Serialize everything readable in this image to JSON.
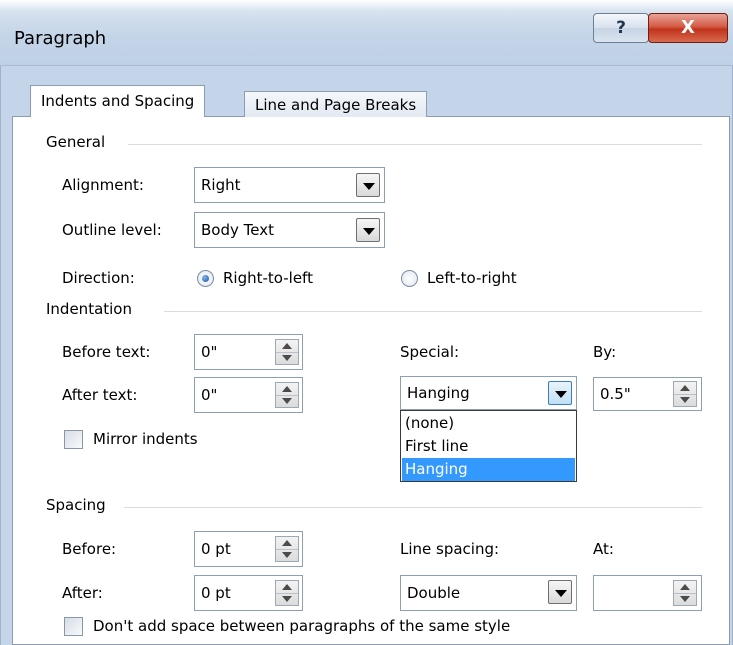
{
  "window": {
    "title": "Paragraph",
    "help_glyph": "?",
    "close_glyph": "X"
  },
  "tabs": [
    {
      "label": "Indents and Spacing",
      "active": true
    },
    {
      "label": "Line and Page Breaks",
      "active": false
    }
  ],
  "general": {
    "heading": "General",
    "alignment": {
      "label": "Alignment:",
      "value": "Right"
    },
    "outline_level": {
      "label": "Outline level:",
      "value": "Body Text"
    },
    "direction": {
      "label": "Direction:",
      "options": [
        {
          "label": "Right-to-left",
          "checked": true
        },
        {
          "label": "Left-to-right",
          "checked": false
        }
      ]
    }
  },
  "indentation": {
    "heading": "Indentation",
    "before_text": {
      "label": "Before text:",
      "value": "0\""
    },
    "after_text": {
      "label": "After text:",
      "value": "0\""
    },
    "special": {
      "label": "Special:",
      "value": "Hanging",
      "options": [
        "(none)",
        "First line",
        "Hanging"
      ],
      "selected_option": "Hanging"
    },
    "by": {
      "label": "By:",
      "value": "0.5\""
    },
    "mirror_indents": {
      "label": "Mirror indents",
      "checked": false
    }
  },
  "spacing": {
    "heading": "Spacing",
    "before": {
      "label": "Before:",
      "value": "0 pt"
    },
    "after": {
      "label": "After:",
      "value": "0 pt"
    },
    "line_spacing": {
      "label": "Line spacing:",
      "value": "Double"
    },
    "at": {
      "label": "At:",
      "value": ""
    },
    "no_space_same_style": {
      "label": "Don't add space between paragraphs of the same style",
      "checked": false
    }
  },
  "colors": {
    "titlebar": "#c3d4e8",
    "close_button": "#c2321b",
    "selection": "#3399ff"
  },
  "icons": [
    "help-icon",
    "close-icon",
    "chevron-down-icon",
    "spin-up-icon",
    "spin-down-icon"
  ]
}
